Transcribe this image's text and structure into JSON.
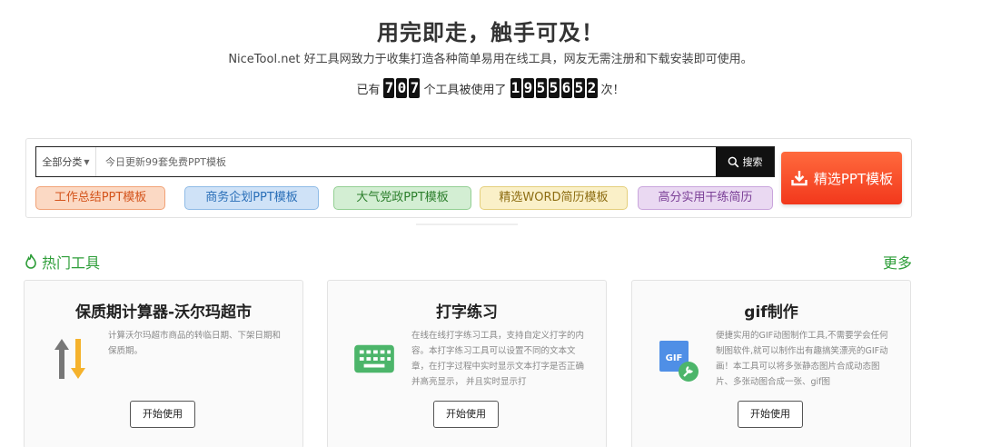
{
  "hero": {
    "title": "用完即走，触手可及！",
    "subtitle": "NiceTool.net 好工具网致力于收集打造各种简单易用在线工具，网友无需注册和下载安装即可使用。",
    "stats_prefix": "已有",
    "tool_count_digits": [
      "7",
      "0",
      "7"
    ],
    "stats_middle": "个工具被使用了",
    "usage_count_digits": [
      "1",
      "9",
      "5",
      "5",
      "6",
      "5",
      "2"
    ],
    "stats_suffix": "次！"
  },
  "search": {
    "category": "全部分类",
    "placeholder": "今日更新99套免费PPT模板",
    "button_label": "搜索"
  },
  "ppt_button_label": "精选PPT模板",
  "tags": [
    {
      "label": "工作总结PPT模板",
      "bg": "#fbd9c4",
      "border": "#f1a277",
      "color": "#d4541c"
    },
    {
      "label": "商务企划PPT模板",
      "bg": "#cfe2f7",
      "border": "#8fbbe6",
      "color": "#2a6fb8"
    },
    {
      "label": "大气党政PPT模板",
      "bg": "#d3eed3",
      "border": "#93cf93",
      "color": "#2c7f2c"
    },
    {
      "label": "精选WORD简历模板",
      "bg": "#faf0c8",
      "border": "#e4cf7c",
      "color": "#8d6d12"
    },
    {
      "label": "高分实用干练简历",
      "bg": "#ead9f2",
      "border": "#c9a5dc",
      "color": "#7a3f96"
    }
  ],
  "section": {
    "title": "热门工具",
    "more": "更多",
    "accent": "#2f9e3a"
  },
  "cards": [
    {
      "title": "保质期计算器-沃尔玛超市",
      "icon": "up-down-arrows-icon",
      "description": "计算沃尔玛超市商品的转临日期、下架日期和保质期。",
      "button": "开始使用"
    },
    {
      "title": "打字练习",
      "icon": "keyboard-icon",
      "description": "在线在线打字练习工具，支持自定义打字的内容。本打字练习工具可以设置不同的文本文章，在打字过程中实时显示文本打字是否正确并高亮显示， 并且实时显示打",
      "button": "开始使用"
    },
    {
      "title": "gif制作",
      "icon": "gif-tool-icon",
      "description": "便捷实用的GIF动图制作工具,不需要学会任何制图软件,就可以制作出有趣搞笑漂亮的GIF动画！本工具可以将多张静态图片合成动态图片、多张动图合成一张、gif图",
      "button": "开始使用"
    }
  ]
}
